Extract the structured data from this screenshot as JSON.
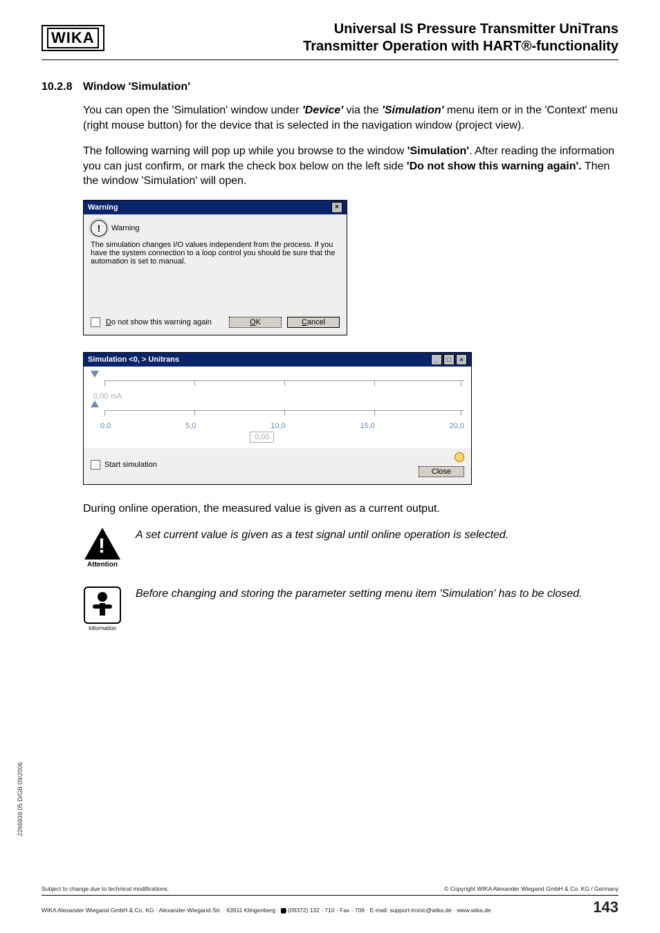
{
  "header": {
    "logo_text": "WIKA",
    "title_line1": "Universal IS Pressure Transmitter UniTrans",
    "title_line2": "Transmitter Operation with HART®-functionality"
  },
  "section": {
    "number": "10.2.8",
    "title": "Window 'Simulation'"
  },
  "paragraphs": {
    "p1_pre": "You can open the 'Simulation' window under ",
    "p1_b1": "'Device'",
    "p1_mid": "  via the ",
    "p1_b2": "'Simulation'",
    "p1_post": " menu item or in the 'Context' menu (right mouse button) for the device that is selected in the navigation window (project view).",
    "p2_pre": "The following warning will pop up while you browse to the window ",
    "p2_b1": "'Simulation'",
    "p2_mid": ". After reading the information you can just confirm, or mark the check box below on the left side ",
    "p2_b2": "'Do not show this warning again'.",
    "p2_post": " Then the window 'Simulation' will open.",
    "p3": "During online operation, the measured value is given as a current output.",
    "note1": "A set current value is given as a test signal until online operation is selected.",
    "note2": "Before changing and storing the parameter setting menu item 'Simulation' has to be closed.",
    "attention_label": "Attention",
    "information_label": "Information"
  },
  "warning_dialog": {
    "title": "Warning",
    "heading": "Warning",
    "body": "The simulation changes I/O values independent from the process. If you have the system connection to a loop control you should be sure that the automation is set to manual.",
    "checkbox_label": "Do not show this warning again",
    "ok": "OK",
    "cancel": "Cancel"
  },
  "sim_window": {
    "title": "Simulation <0,         > Unitrans",
    "current_value": "0,00 mA",
    "scale": {
      "s0": "0,0",
      "s1": "5,0",
      "s2": "10,0",
      "s3": "15,0",
      "s4": "20,0"
    },
    "value_box": "0,00",
    "start_label": "Start simulation",
    "close": "Close"
  },
  "footer": {
    "side_code": "2266939.05 D/GB 09/2006",
    "left": "Subject to change due to technical modifications.",
    "right": "© Copyright WIKA Alexander Wiegand GmbH & Co. KG / Germany",
    "bottom": "WIKA Alexander Wiegand GmbH & Co. KG · Alexander-Wiegand-Str. · 63911 Klingenberg · ",
    "bottom2": " (09372) 132 - 710 · Fax - 706 · E-mail: support-tronic@wika.de · www.wika.de",
    "page_number": "143"
  }
}
